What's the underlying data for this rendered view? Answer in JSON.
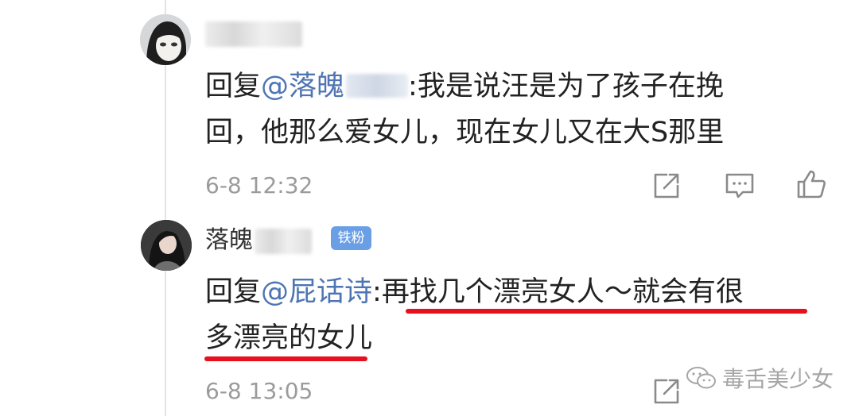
{
  "comments": [
    {
      "username": "",
      "reply_prefix": "回复",
      "mention": "@落魄",
      "separator": ":",
      "text_line1": "我是说汪是为了孩子在挽",
      "text_line2": "回，他那么爱女儿，现在女儿又在大S那里",
      "timestamp": "6-8 12:32"
    },
    {
      "username": "落魄",
      "badge": "铁粉",
      "reply_prefix": "回复",
      "mention": "@屁话诗",
      "separator": ":",
      "text_line1": "再找几个漂亮女人～就会有很",
      "text_line2": "多漂亮的女儿",
      "timestamp": "6-8 13:05"
    }
  ],
  "icons": [
    "share-icon",
    "comment-icon",
    "like-icon"
  ],
  "watermark": {
    "text": "毒舌美少女",
    "icon": "wechat-icon"
  },
  "colors": {
    "mention": "#4e75b3",
    "underline": "#e6101e",
    "badge": "#6a9fe6",
    "meta": "#9b9b9b"
  }
}
